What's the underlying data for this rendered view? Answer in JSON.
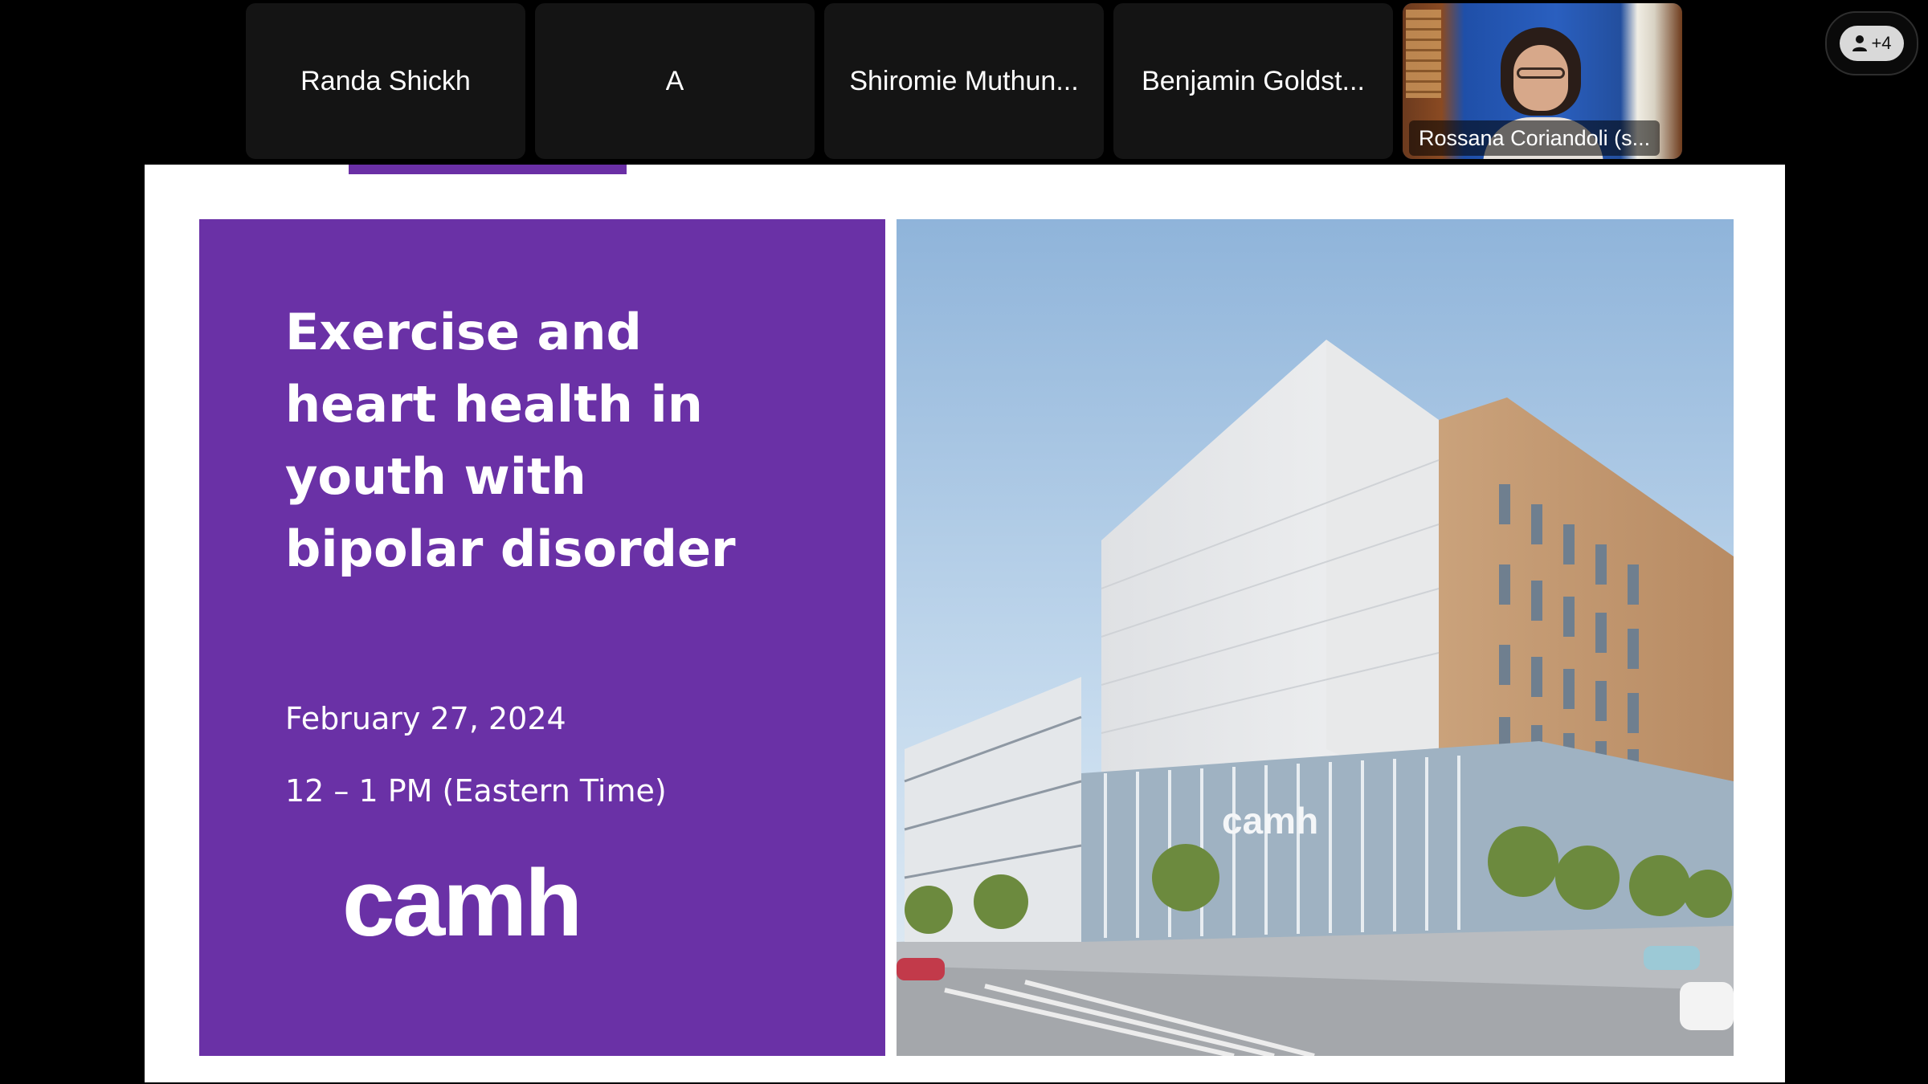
{
  "meeting": {
    "participants": [
      {
        "name": "Randa Shickh"
      },
      {
        "name": "A"
      },
      {
        "name": "Shiromie Muthun..."
      },
      {
        "name": "Benjamin Goldst..."
      }
    ],
    "video_participant": {
      "name": "Rossana Coriandoli (s..."
    },
    "more_participants": "+4"
  },
  "slide": {
    "title": "Exercise and heart health in youth with bipolar disorder",
    "date": "February 27, 2024",
    "time": "12 – 1 PM (Eastern Time)",
    "logo": "camh",
    "building_sign": "camh"
  },
  "colors": {
    "slide_purple": "#6a31a6",
    "background": "#000000",
    "tile": "#141414"
  },
  "icons": {
    "people": "person-icon"
  }
}
